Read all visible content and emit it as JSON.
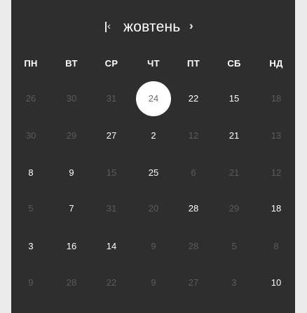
{
  "header": {
    "prev_glyph": "‹",
    "next_glyph": "›",
    "month_title": "жовтень"
  },
  "weekdays": [
    "ПН",
    "ВТ",
    "СР",
    "ЧТ",
    "ПТ",
    "СБ",
    "НД"
  ],
  "weeks": [
    [
      {
        "t": "26",
        "m": true
      },
      {
        "t": "30",
        "m": true
      },
      {
        "t": "31",
        "m": true
      },
      {
        "t": "24",
        "s": true
      },
      {
        "t": "22"
      },
      {
        "t": "15"
      },
      {
        "t": "18",
        "m": true
      }
    ],
    [
      {
        "t": "30",
        "m": true
      },
      {
        "t": "29",
        "m": true
      },
      {
        "t": "27"
      },
      {
        "t": "2"
      },
      {
        "t": "12",
        "m": true
      },
      {
        "t": "21"
      },
      {
        "t": "13",
        "m": true
      }
    ],
    [
      {
        "t": "8"
      },
      {
        "t": "9"
      },
      {
        "t": "15",
        "m": true
      },
      {
        "t": "25"
      },
      {
        "t": "6",
        "m": true
      },
      {
        "t": "21",
        "m": true
      },
      {
        "t": "12",
        "m": true
      }
    ],
    [
      {
        "t": "5",
        "m": true
      },
      {
        "t": "7"
      },
      {
        "t": "31",
        "m": true
      },
      {
        "t": "20",
        "m": true
      },
      {
        "t": "28"
      },
      {
        "t": "29",
        "m": true
      },
      {
        "t": "18"
      }
    ],
    [
      {
        "t": "3"
      },
      {
        "t": "16"
      },
      {
        "t": "14"
      },
      {
        "t": "9",
        "m": true
      },
      {
        "t": "28",
        "m": true
      },
      {
        "t": "5",
        "m": true
      },
      {
        "t": "8",
        "m": true
      }
    ],
    [
      {
        "t": "9",
        "m": true
      },
      {
        "t": "28",
        "m": true
      },
      {
        "t": "22",
        "m": true
      },
      {
        "t": "9",
        "m": true
      },
      {
        "t": "27",
        "m": true
      },
      {
        "t": "3",
        "m": true
      },
      {
        "t": "10"
      }
    ]
  ],
  "colors": {
    "panel_background": "#2f2e2e",
    "page_background": "#ebebeb",
    "text": "#ffffff",
    "muted_text": "#5c5b5b",
    "selected_background": "#ffffff",
    "selected_text": "#6d6d6d"
  }
}
